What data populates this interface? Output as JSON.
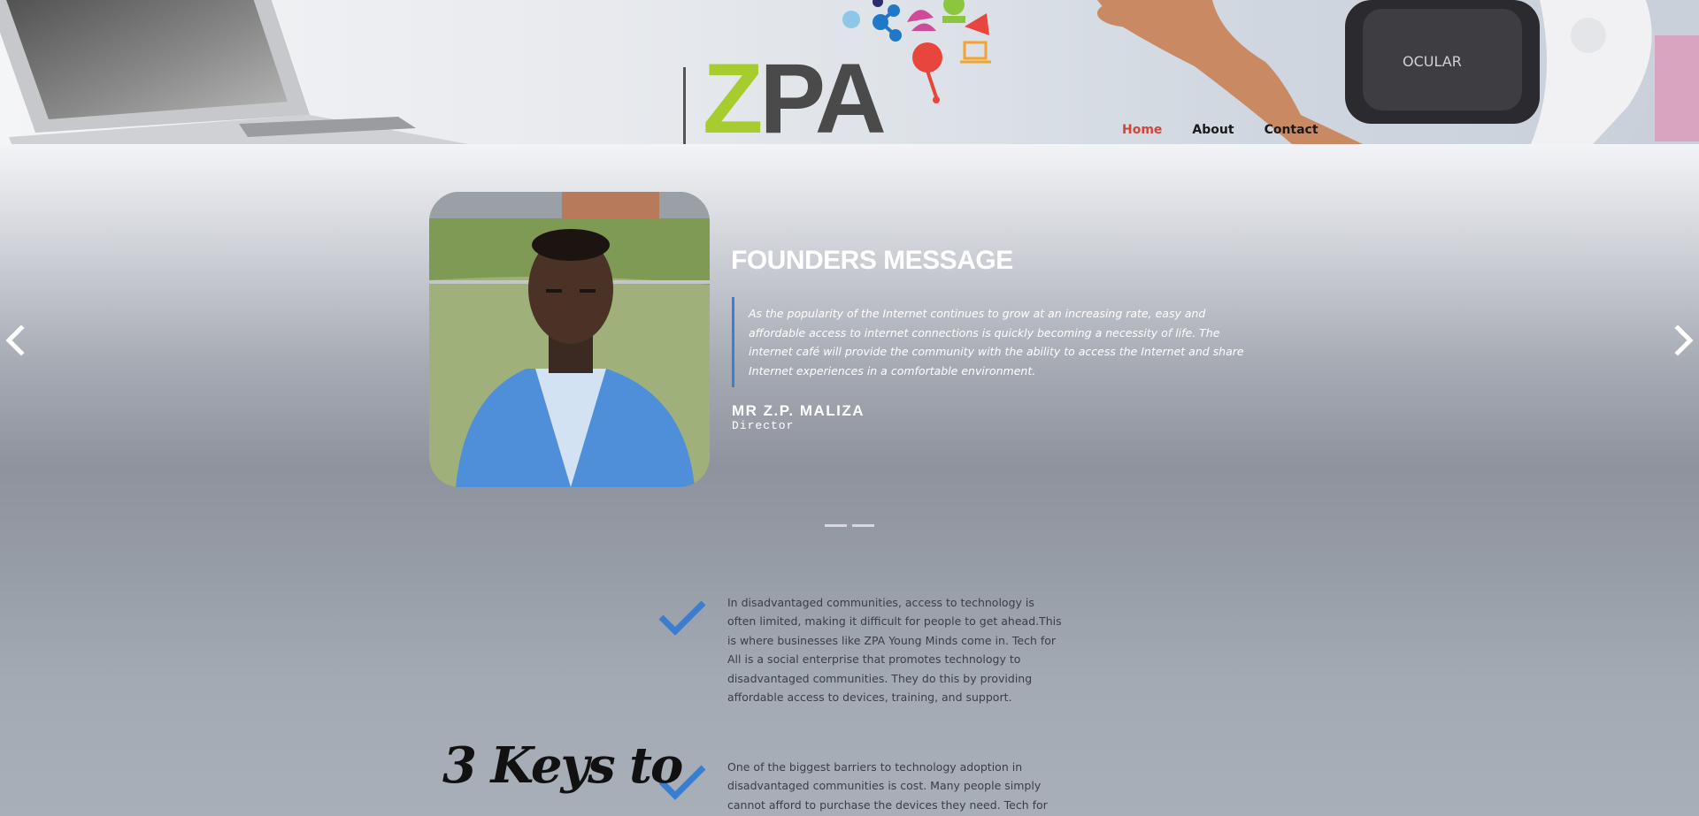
{
  "logo": {
    "z": "Z",
    "p": "P",
    "a": "A",
    "vr_brand": "OCULAR"
  },
  "nav": {
    "home": "Home",
    "about": "About",
    "contact": "Contact"
  },
  "colors": {
    "accent_red": "#d0463d",
    "quote_border": "#3b7fd1",
    "check_blue": "#3a7ed2",
    "logo_green": "#a6cc2e"
  },
  "icons": {
    "prev": "chevron-left-icon",
    "next": "chevron-right-icon",
    "check": "checkmark-icon"
  },
  "founder": {
    "title": "FOUNDERS MESSAGE",
    "quote": "As the popularity of the Internet continues to grow at an increasing rate, easy and affordable access to internet connections is quickly becoming a necessity of life. The internet café will provide the community with the ability to access the Internet and share Internet experiences in a comfortable environment.",
    "name": "MR Z.P. MALIZA",
    "role": "Director"
  },
  "features": [
    {
      "text": "In disadvantaged communities, access to technology is often limited, making it difficult for people to get ahead.This is where businesses like ZPA Young Minds come in. Tech for All is a social enterprise that promotes technology to disadvantaged communities. They do this by providing affordable access to devices, training, and support."
    },
    {
      "text": "One of the biggest barriers to technology adoption in disadvantaged communities is cost. Many people simply cannot afford to purchase the devices they need. Tech for"
    }
  ],
  "keys_heading": "3 Keys to"
}
